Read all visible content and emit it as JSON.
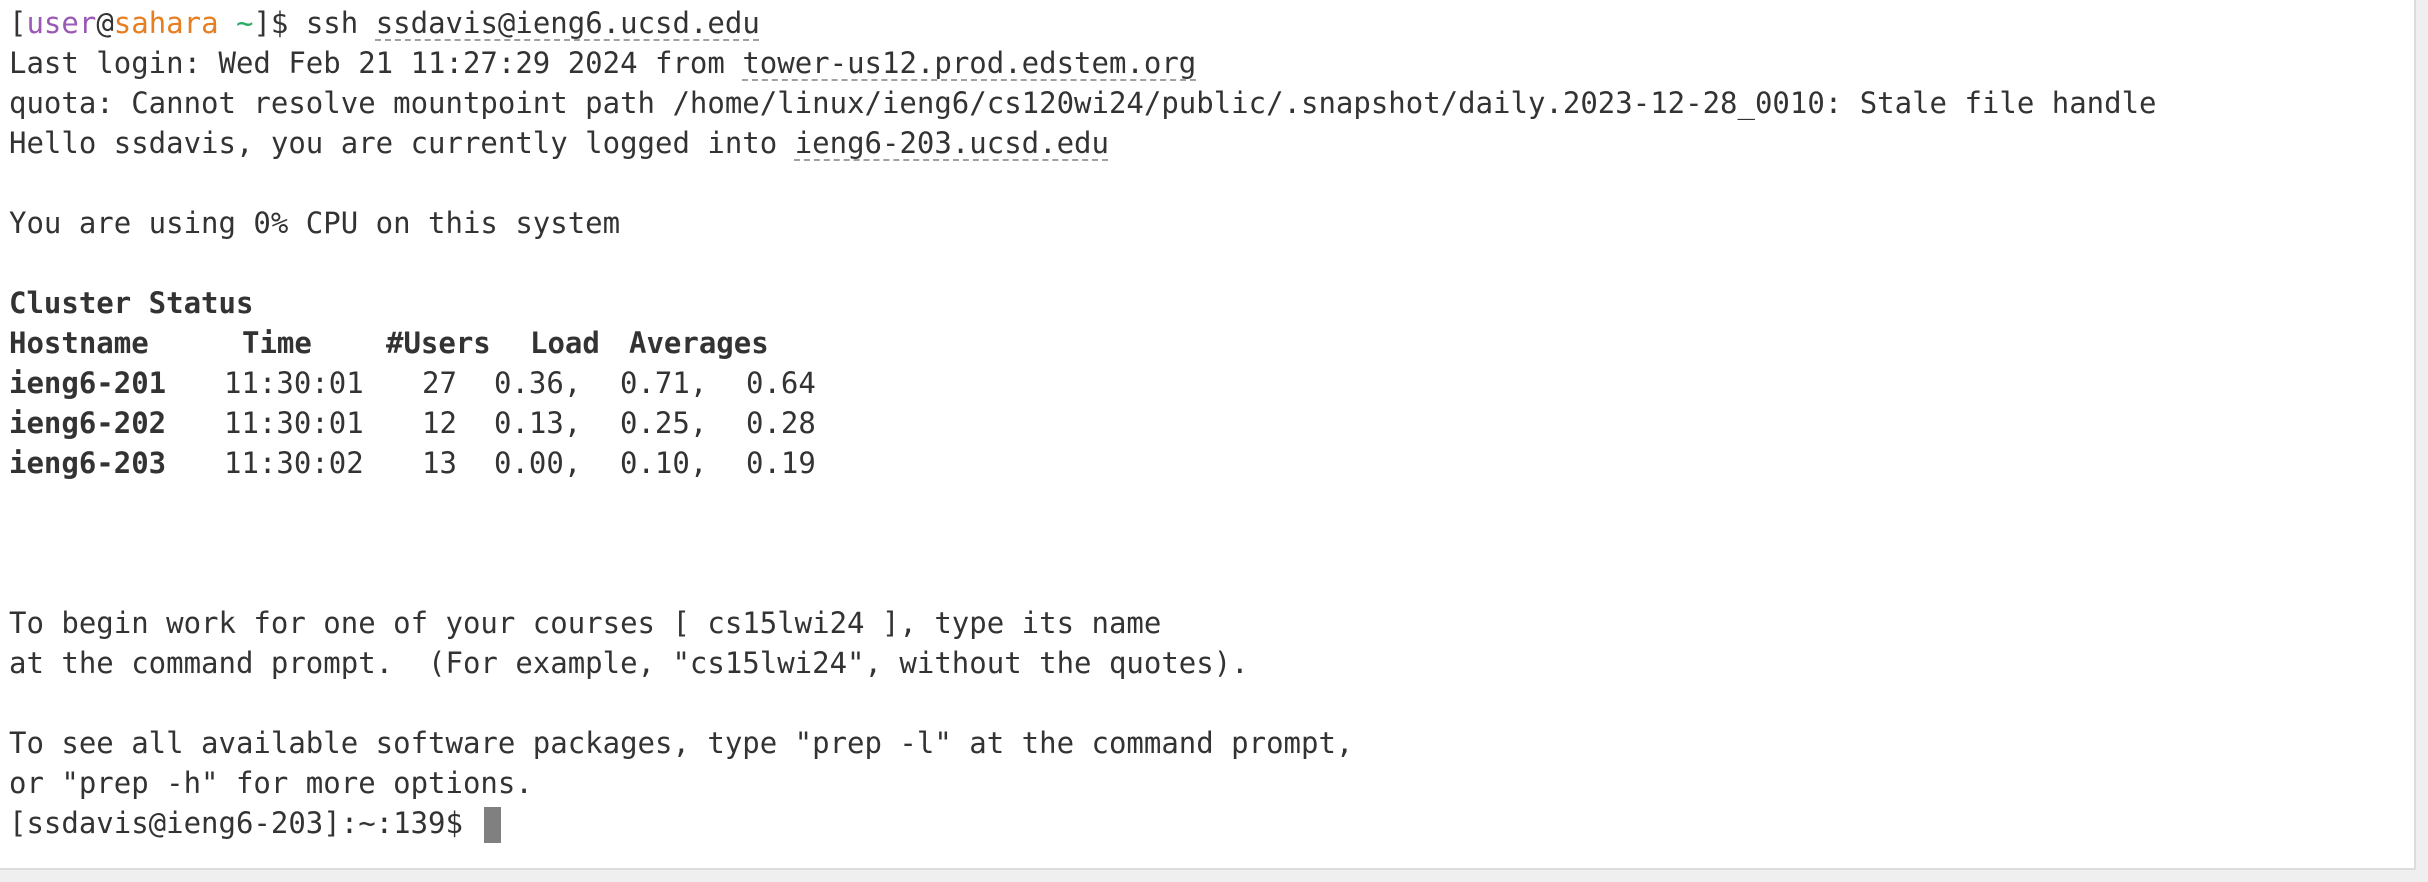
{
  "terminal": {
    "cmd": {
      "open": "[",
      "user": "user",
      "at": "@",
      "host": "sahara",
      "tilde": " ~",
      "close": "]$ ssh ",
      "target": "ssdavis@ieng6.ucsd.edu"
    },
    "last_login": {
      "prefix": "Last login: Wed Feb 21 11:27:29 2024 from ",
      "host": "tower-us12.prod.edstem.org"
    },
    "quota_line": "quota: Cannot resolve mountpoint path /home/linux/ieng6/cs120wi24/public/.snapshot/daily.2023-12-28_0010: Stale file handle",
    "hello": {
      "prefix": "Hello ssdavis, you are currently logged into ",
      "host": "ieng6-203.ucsd.edu"
    },
    "cpu_line": "You are using 0% CPU on this system",
    "cluster": {
      "title": "Cluster Status",
      "headers": [
        "Hostname",
        "Time",
        "#Users",
        "Load",
        "Averages"
      ],
      "rows": [
        {
          "host": "ieng6-201",
          "time": "11:30:01",
          "users": "27",
          "l1": "0.36,",
          "l5": "0.71,",
          "l15": "0.64"
        },
        {
          "host": "ieng6-202",
          "time": "11:30:01",
          "users": "12",
          "l1": "0.13,",
          "l5": "0.25,",
          "l15": "0.28"
        },
        {
          "host": "ieng6-203",
          "time": "11:30:02",
          "users": "13",
          "l1": "0.00,",
          "l5": "0.10,",
          "l15": "0.19"
        }
      ]
    },
    "course_msg": [
      "To begin work for one of your courses [ cs15lwi24 ], type its name",
      "at the command prompt.  (For example, \"cs15lwi24\", without the quotes)."
    ],
    "prep_msg": [
      "To see all available software packages, type \"prep -l\" at the command prompt,",
      "or \"prep -h\" for more options."
    ],
    "prompt": "[ssdavis@ieng6-203]:~:139$ "
  }
}
